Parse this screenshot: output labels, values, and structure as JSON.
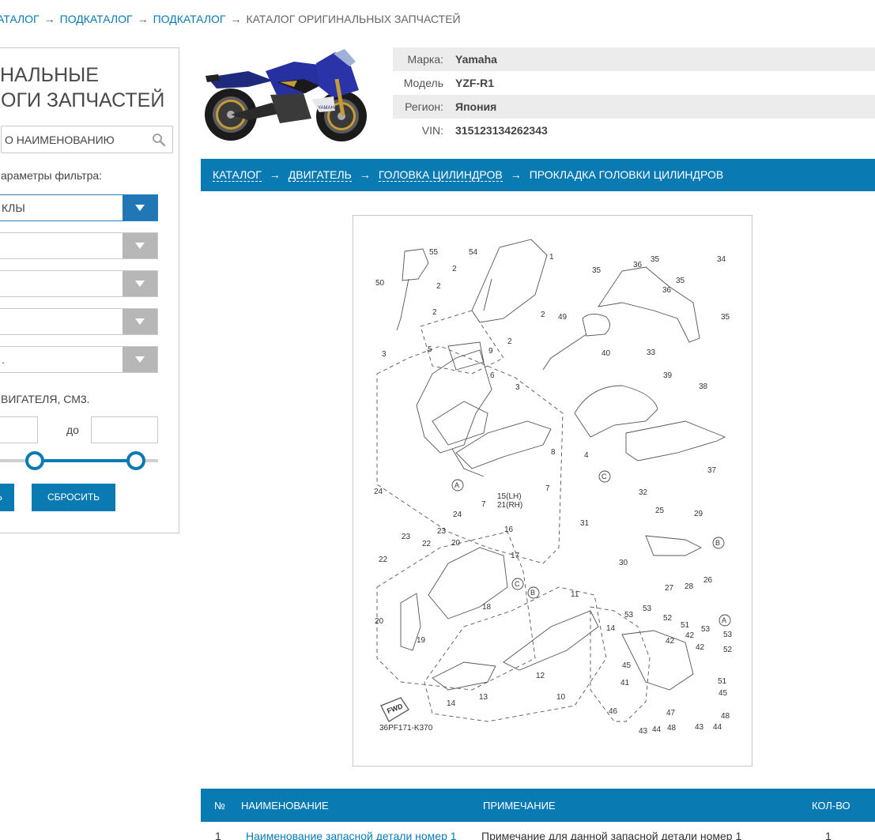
{
  "breadcrumb": {
    "items": [
      "АТАЛОГ",
      "ПОДКАТАЛОГ",
      "ПОДКАТАЛОГ"
    ],
    "separator": "→",
    "current": "КАТАЛОГ ОРИГИНАЛЬНЫХ ЗАПЧАСТЕЙ"
  },
  "sidebar": {
    "title_line1": "НАЛЬНЫЕ",
    "title_line2": "ОГИ ЗАПЧАСТЕЙ",
    "search_value": "О НАИМЕНОВАНИЮ",
    "filter_label": "араметры фильтра:",
    "selects": [
      "КЛЫ",
      "",
      "",
      "",
      "."
    ],
    "volume_label": "ВИГАТЕЛЯ, СМ3.",
    "range_to": "до",
    "apply_label": "Ь",
    "reset_label": "СБРОСИТЬ"
  },
  "vehicle": {
    "rows": [
      {
        "key": "Марка:",
        "value": "Yamaha"
      },
      {
        "key": "Модель",
        "value": "YZF-R1"
      },
      {
        "key": "Регион:",
        "value": "Япония"
      },
      {
        "key": "VIN:",
        "value": "315123134262343"
      }
    ]
  },
  "path_bar": {
    "links": [
      "КАТАЛОГ",
      "ДВИГАТЕЛЬ",
      "ГОЛОВКА ЦИЛИНДРОВ"
    ],
    "current": "ПРОКЛАДКА ГОЛОВКИ ЦИЛИНДРОВ",
    "separator": "→"
  },
  "diagram": {
    "code": "36PF171-K370",
    "fwd_label": "FWD",
    "callouts": [
      "1",
      "2",
      "3",
      "4",
      "5",
      "6",
      "7",
      "8",
      "9",
      "10",
      "11",
      "12",
      "13",
      "14",
      "15(LH)",
      "16",
      "17",
      "18",
      "19",
      "20",
      "21(RH)",
      "22",
      "23",
      "24",
      "25",
      "26",
      "27",
      "28",
      "29",
      "30",
      "31",
      "32",
      "33",
      "34",
      "35",
      "36",
      "37",
      "38",
      "39",
      "40",
      "41",
      "42",
      "43",
      "44",
      "45",
      "46",
      "47",
      "48",
      "49",
      "50",
      "51",
      "52",
      "53",
      "54",
      "55"
    ]
  },
  "parts_table": {
    "headers": {
      "num": "№",
      "name": "НАИМЕНОВАНИЕ",
      "note": "ПРИМЕЧАНИЕ",
      "qty": "КОЛ-ВО"
    },
    "rows": [
      {
        "num": "1",
        "name": "Наименование запасной детали номер 1",
        "note": "Примечание для данной запасной детали номер 1",
        "qty": "1"
      }
    ]
  },
  "colors": {
    "accent": "#0a7ab3",
    "select_active": "#2176b5",
    "select_inactive": "#b7b7b7"
  }
}
